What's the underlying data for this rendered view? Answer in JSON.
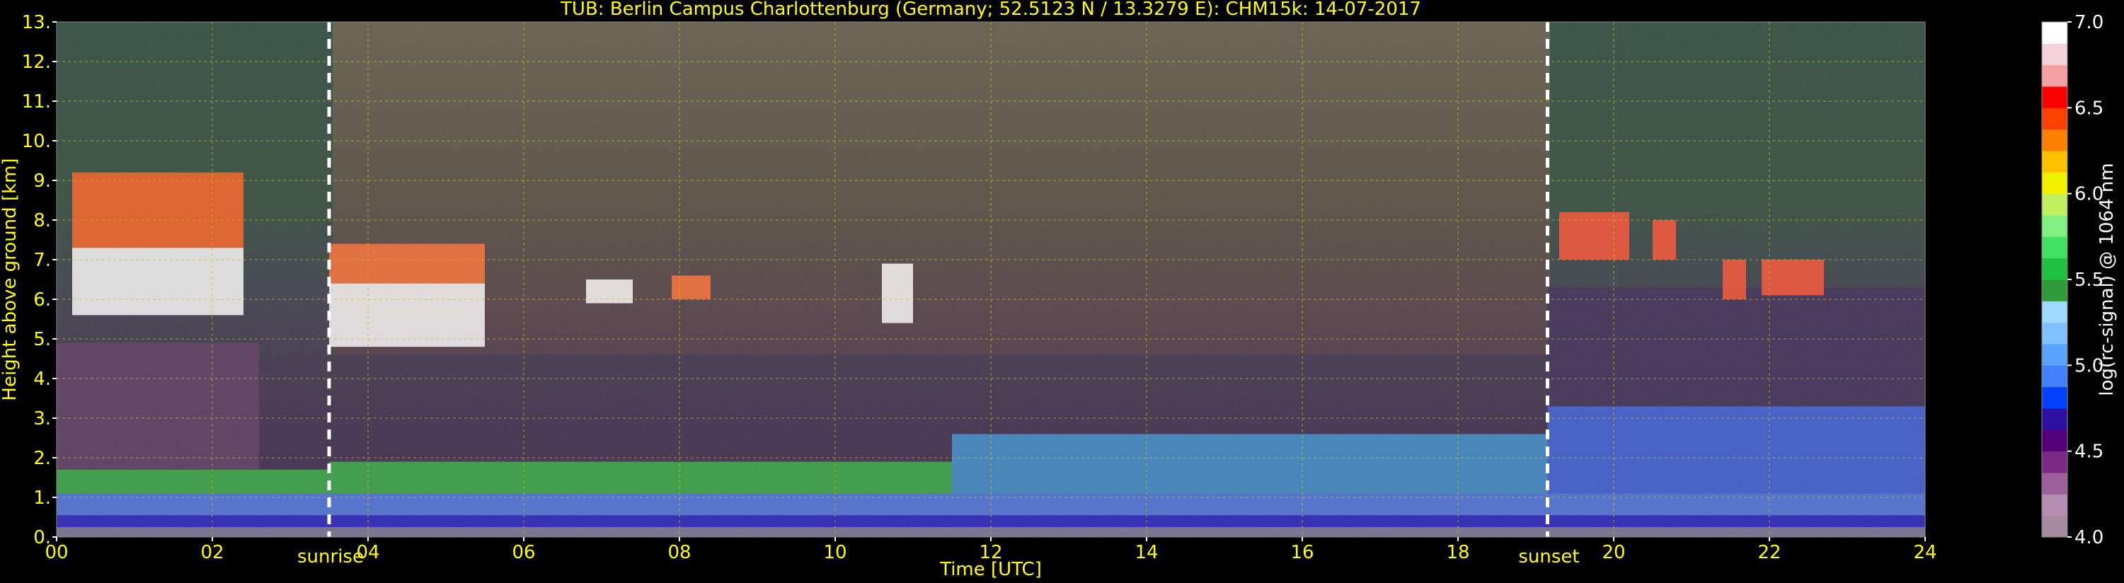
{
  "chart_data": {
    "type": "heatmap",
    "title": "TUB: Berlin Campus Charlottenburg (Germany; 52.5123 N / 13.3279 E):    CHM15k: 14-07-2017",
    "xlabel": "Time [UTC]",
    "ylabel": "Height above ground [km]",
    "xlim": [
      0,
      24
    ],
    "ylim": [
      0,
      13
    ],
    "x_ticks": [
      "00",
      "02",
      "04",
      "06",
      "08",
      "10",
      "12",
      "14",
      "16",
      "18",
      "20",
      "22",
      "24"
    ],
    "x_tick_values": [
      0,
      2,
      4,
      6,
      8,
      10,
      12,
      14,
      16,
      18,
      20,
      22,
      24
    ],
    "y_ticks": [
      "0.",
      "1.",
      "2.",
      "3.",
      "4.",
      "5.",
      "6.",
      "7.",
      "8.",
      "9.",
      "10.",
      "11.",
      "12.",
      "13."
    ],
    "y_tick_values": [
      0,
      1,
      2,
      3,
      4,
      5,
      6,
      7,
      8,
      9,
      10,
      11,
      12,
      13
    ],
    "grid": true,
    "annotations": [
      {
        "label": "sunrise",
        "x": 3.5
      },
      {
        "label": "sunset",
        "x": 19.15
      }
    ],
    "colorbar": {
      "label": "log(rc-signal) @ 1064 nm",
      "range": [
        4.0,
        7.0
      ],
      "ticks": [
        "4.0",
        "4.5",
        "5.0",
        "5.5",
        "6.0",
        "6.5",
        "7.0"
      ],
      "tick_values": [
        4.0,
        4.5,
        5.0,
        5.5,
        6.0,
        6.5,
        7.0
      ],
      "colors": [
        "#a58aa0",
        "#b48cb0",
        "#9b5f9b",
        "#7a2a84",
        "#52007a",
        "#2a0fa0",
        "#0040ff",
        "#4080ff",
        "#5aa0ff",
        "#7fc0ff",
        "#a0d8ff",
        "#2f9a3a",
        "#20c040",
        "#40e060",
        "#80f080",
        "#c0f060",
        "#f0f000",
        "#ffc000",
        "#ff8000",
        "#ff4000",
        "#ff0000",
        "#f4a0a0",
        "#f4d0d8",
        "#ffffff"
      ]
    },
    "layers": [
      {
        "name": "surface",
        "t0": 0,
        "t1": 24,
        "h0": 0,
        "h1": 0.25,
        "color": "#7a7a9a"
      },
      {
        "name": "near-ground",
        "t0": 0,
        "t1": 24,
        "h0": 0.25,
        "h1": 0.55,
        "color": "#2020c8"
      },
      {
        "name": "boundary-lower",
        "t0": 0,
        "t1": 24,
        "h0": 0.55,
        "h1": 1.1,
        "color": "#4a78e8"
      },
      {
        "name": "boundary-upper",
        "t0": 0,
        "t1": 3.5,
        "h0": 1.1,
        "h1": 1.7,
        "color": "#30b040"
      },
      {
        "name": "boundary-day",
        "t0": 3.5,
        "t1": 11.5,
        "h0": 1.1,
        "h1": 1.9,
        "color": "#30b040"
      },
      {
        "name": "boundary-afternoon",
        "t0": 11.5,
        "t1": 19.15,
        "h0": 1.1,
        "h1": 2.6,
        "color": "#3a90d0"
      },
      {
        "name": "residual-evening",
        "t0": 19.15,
        "t1": 24,
        "h0": 1.1,
        "h1": 3.3,
        "color": "#3a60e0"
      },
      {
        "name": "aerosol-night-left",
        "t0": 0,
        "t1": 2.6,
        "h0": 1.7,
        "h1": 4.9,
        "color": "#5a3a60"
      },
      {
        "name": "aerosol-night-right",
        "t0": 19.15,
        "t1": 24,
        "h0": 3.3,
        "h1": 6.3,
        "color": "#3a2a55"
      }
    ],
    "cloud_patches": [
      {
        "t0": 0.2,
        "t1": 2.4,
        "h0": 5.6,
        "h1": 7.3,
        "color": "#ffffff"
      },
      {
        "t0": 0.2,
        "t1": 2.4,
        "h0": 7.3,
        "h1": 9.2,
        "color": "#ff6020"
      },
      {
        "t0": 3.5,
        "t1": 5.5,
        "h0": 4.8,
        "h1": 6.4,
        "color": "#ffffff"
      },
      {
        "t0": 3.5,
        "t1": 5.5,
        "h0": 6.4,
        "h1": 7.4,
        "color": "#ff7030"
      },
      {
        "t0": 6.8,
        "t1": 7.4,
        "h0": 5.9,
        "h1": 6.5,
        "color": "#ffffff"
      },
      {
        "t0": 7.9,
        "t1": 8.4,
        "h0": 6.0,
        "h1": 6.6,
        "color": "#ff7030"
      },
      {
        "t0": 10.6,
        "t1": 11.0,
        "h0": 5.4,
        "h1": 6.9,
        "color": "#ffffff"
      },
      {
        "t0": 19.3,
        "t1": 20.2,
        "h0": 7.0,
        "h1": 8.2,
        "color": "#ff5030"
      },
      {
        "t0": 20.5,
        "t1": 20.8,
        "h0": 7.0,
        "h1": 8.0,
        "color": "#ff5030"
      },
      {
        "t0": 21.4,
        "t1": 21.7,
        "h0": 6.0,
        "h1": 7.0,
        "color": "#ff5030"
      },
      {
        "t0": 21.9,
        "t1": 22.7,
        "h0": 6.1,
        "h1": 7.0,
        "color": "#ff5030"
      }
    ]
  }
}
